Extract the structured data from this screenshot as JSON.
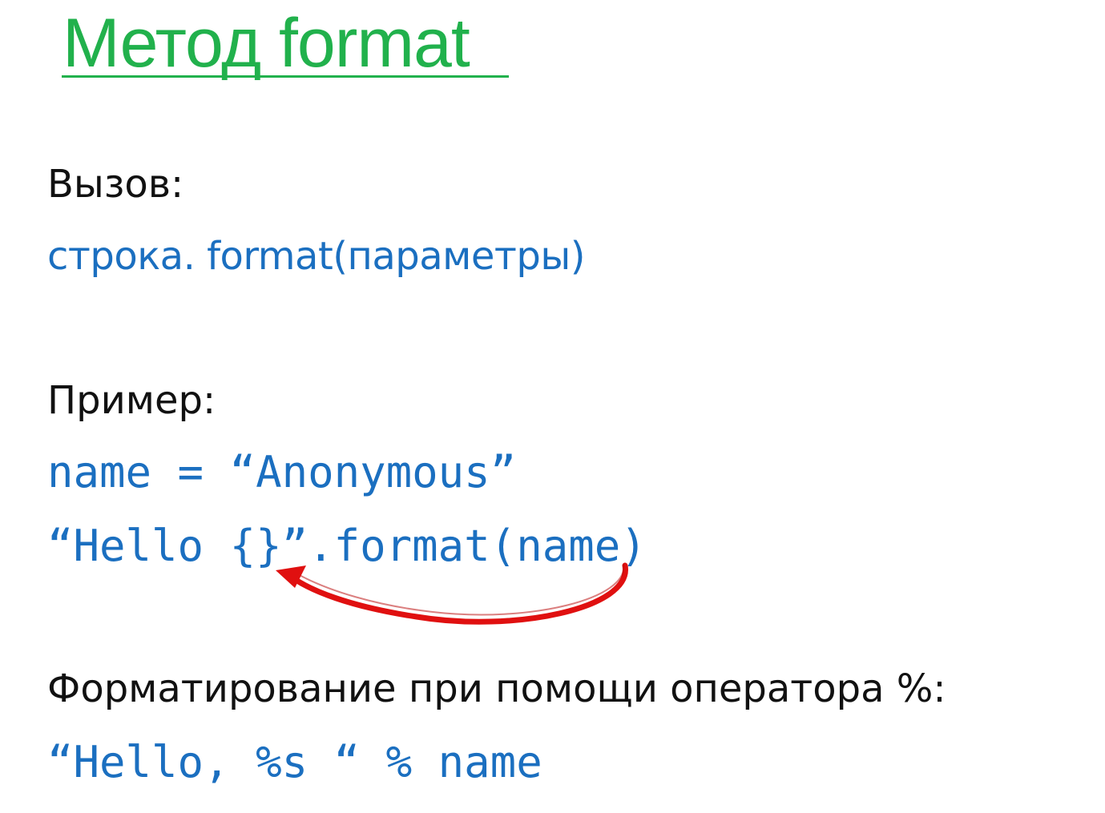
{
  "slide": {
    "title": "Метод format",
    "call_label": "Вызов:",
    "call_syntax": "строка. format(параметры)",
    "example_label": "Пример:",
    "example_line1": "name = “Anonymous”",
    "example_line2": "“Hello {}”.format(name)",
    "percent_label": "Форматирование при помощи оператора %:",
    "percent_example": "“Hello, %s “ % name"
  },
  "colors": {
    "title": "#21b14c",
    "code": "#1b6fc0",
    "text": "#111111",
    "arrow": "#e01010"
  }
}
